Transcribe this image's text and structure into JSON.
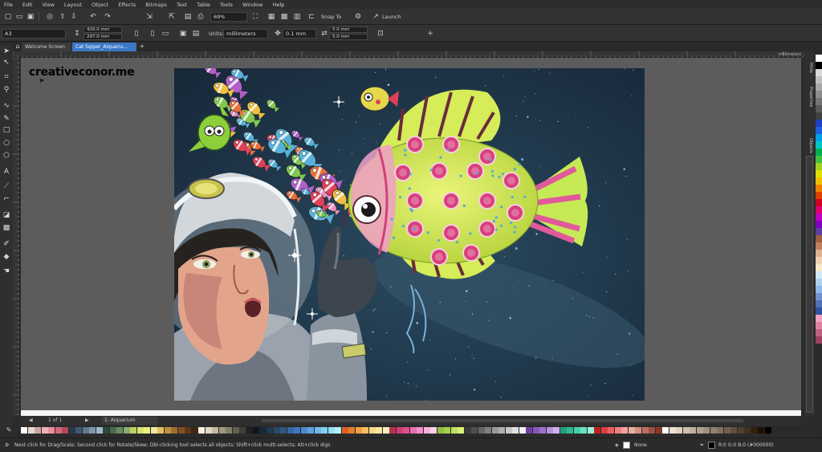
{
  "menu": [
    "File",
    "Edit",
    "View",
    "Layout",
    "Object",
    "Effects",
    "Bitmaps",
    "Text",
    "Table",
    "Tools",
    "Window",
    "Help"
  ],
  "toolbar": {
    "zoom": "69%",
    "snap_label": "Snap To",
    "launch_label": "Launch"
  },
  "property_bar": {
    "page_size": "A3",
    "width": "420.0 mm",
    "height": "297.0 mm",
    "units_label": "Units:",
    "units_value": "millimeters",
    "nudge": "0.1 mm",
    "dup_x": "5.0 mm",
    "dup_y": "5.0 mm"
  },
  "tabs": [
    {
      "label": "Welcome Screen"
    },
    {
      "label": "Cat Sqiper_Aiquariu..."
    }
  ],
  "ruler_unit": "millimeters",
  "watermark": "creativeconor.me",
  "docker_tabs": [
    "Hints",
    "Properties",
    "Objects"
  ],
  "page_nav": {
    "counter": "1 of 1",
    "page_tab": "1: Aiquarium"
  },
  "status": {
    "hint": "Next click for Drag/Scale; Second click for Rotate/Skew; Dbl-clicking tool selects all objects; Shift+click multi-selects; Alt+click digs",
    "fill": "None",
    "outline": "R:0 G:0 B:0 (#000000)"
  },
  "colors": {
    "active_tab": "#3b78c7",
    "canvas": "#5c5c5c",
    "space_bg": "#1d3142"
  }
}
